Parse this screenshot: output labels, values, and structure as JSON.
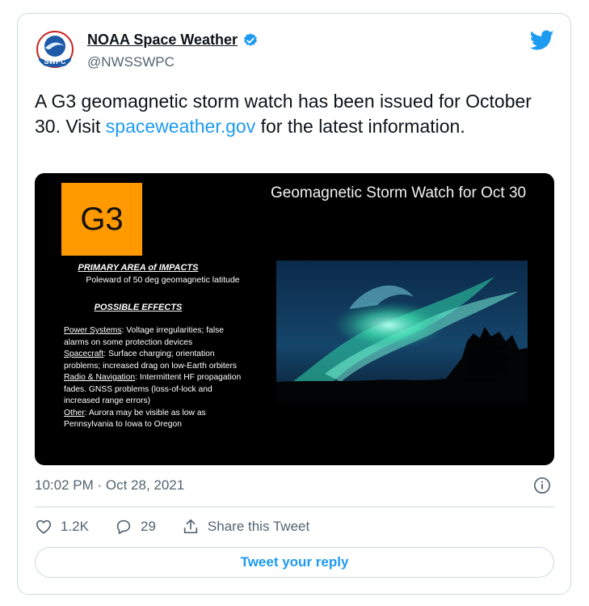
{
  "tweet": {
    "author_name": "NOAA Space Weather",
    "author_handle": "@NWSSWPC",
    "logo_text": "SWPC",
    "text_before_link": "A G3 geomagnetic storm watch has been issued for October 30.  Visit ",
    "link_text": "spaceweather.gov",
    "text_after_link": " for the latest information.",
    "timestamp": "10:02 PM · Oct 28, 2021"
  },
  "media": {
    "badge": "G3",
    "title": "Geomagnetic Storm Watch for Oct 30",
    "impacts_heading": "PRIMARY AREA of IMPACTS",
    "impacts_text": "Poleward of 50 deg geomagnetic latitude",
    "effects_heading": "POSSIBLE EFFECTS",
    "effects": [
      {
        "label": "Power Systems",
        "text": ": Voltage irregularities; false alarms on some protection devices"
      },
      {
        "label": "Spacecraft",
        "text": ": Surface charging; orientation problems; increased drag on low-Earth orbiters"
      },
      {
        "label": "Radio & Navigation",
        "text": ": Intermittent HF propagation fades. GNSS problems (loss-of-lock and increased range errors)"
      },
      {
        "label": "Other",
        "text": ": Aurora may be visible as low as Pennsylvania to Iowa to Oregon"
      }
    ]
  },
  "actions": {
    "likes": "1.2K",
    "replies": "29",
    "share_label": "Share this Tweet",
    "reply_button": "Tweet your reply"
  },
  "colors": {
    "accent": "#1d9bf0",
    "badge_orange": "#ff9900",
    "muted_text": "#536471"
  },
  "icons": [
    "noaa-logo-icon",
    "verified-badge-icon",
    "twitter-bird-icon",
    "info-icon",
    "heart-icon",
    "reply-bubble-icon",
    "share-icon"
  ]
}
